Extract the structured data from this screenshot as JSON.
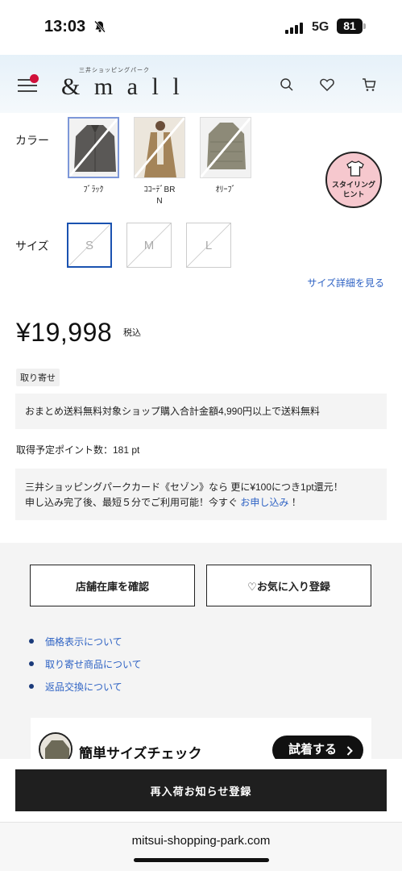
{
  "status_bar": {
    "time": "13:03",
    "network": "5G",
    "battery": "81"
  },
  "header": {
    "logo_sub": "三井ショッピングパーク",
    "logo": "& m a l l"
  },
  "color": {
    "label": "カラー",
    "swatches": [
      {
        "name": "ﾌﾞﾗｯｸ",
        "fill": "#5a5856"
      },
      {
        "name": "ｺｺｰﾃﾞBR\nN",
        "fill": "#a48459"
      },
      {
        "name": "ｵﾘｰﾌﾞ",
        "fill": "#8d8a78"
      }
    ]
  },
  "size": {
    "label": "サイズ",
    "options": [
      "S",
      "M",
      "L"
    ],
    "detail_link": "サイズ詳細を見る"
  },
  "styling_hint": {
    "line1": "スタイリング",
    "line2": "ヒント"
  },
  "price": {
    "amount": "¥19,998",
    "tax": "税込"
  },
  "tag": "取り寄せ",
  "shipping_note": "おまとめ送料無料対象ショップ購入合計金額4,990円以上で送料無料",
  "points": "取得予定ポイント数：181 pt",
  "card_promo": {
    "line1": "三井ショッピングパークカード《セゾン》なら 更に¥100につき1pt還元！",
    "line2_before": "申し込み完了後、最短５分でご利用可能！今すぐ",
    "link": "お申し込み",
    "line2_after": "！"
  },
  "buttons": {
    "stock": "店舗在庫を確認",
    "favorite": "♡お気に入り登録"
  },
  "links": [
    "価格表示について",
    "取り寄せ商品について",
    "返品交換について"
  ],
  "size_check": {
    "title": "簡単サイズチェック",
    "button": "試着する"
  },
  "restock_button": "再入荷お知らせ登録",
  "url": "mitsui-shopping-park.com",
  "colors": {
    "accent_blue": "#2f63c4",
    "selected_size_border": "#1a52b0",
    "hint_pink": "#f6c8ce",
    "menu_dot": "#d0103a"
  }
}
